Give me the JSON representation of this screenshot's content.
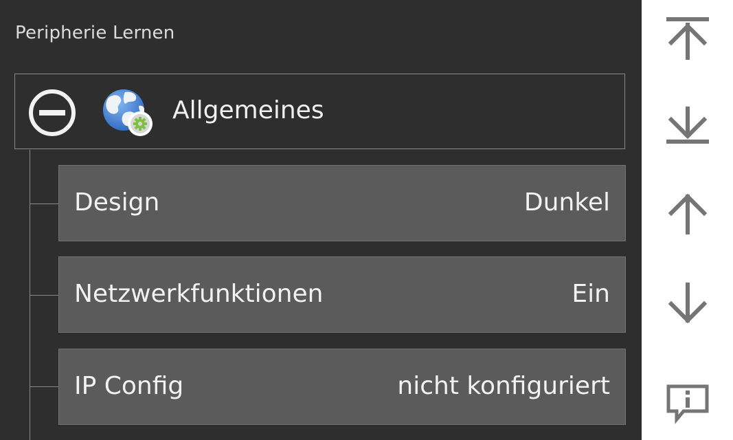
{
  "panel": {
    "title": "Peripherie Lernen"
  },
  "group": {
    "label": "Allgemeines",
    "toggle_icon": "collapse-minus-circle-icon",
    "icon": "globe-settings-icon"
  },
  "rows": [
    {
      "label": "Design",
      "value": "Dunkel"
    },
    {
      "label": "Netzwerkfunktionen",
      "value": "Ein"
    },
    {
      "label": "IP Config",
      "value": "nicht konfiguriert"
    }
  ],
  "sidebar": {
    "buttons": [
      {
        "icon": "move-to-top-icon"
      },
      {
        "icon": "move-to-bottom-icon"
      },
      {
        "icon": "arrow-up-icon"
      },
      {
        "icon": "arrow-down-icon"
      },
      {
        "icon": "info-comment-icon"
      }
    ]
  },
  "colors": {
    "background": "#2e2e2e",
    "row": "#5b5b5b",
    "sidebar": "#ffffff",
    "icon": "#757575",
    "globe": "#3f7fd6",
    "gear": "#7fbf3f"
  }
}
